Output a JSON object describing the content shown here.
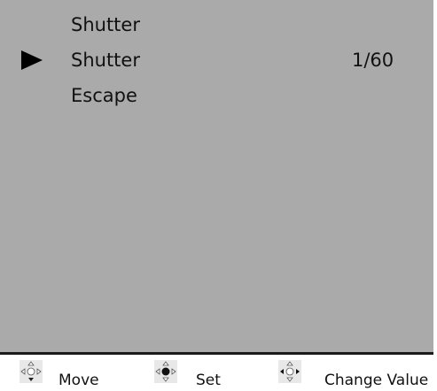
{
  "menu": {
    "items": [
      {
        "label": "Shutter",
        "value": "",
        "selected": false
      },
      {
        "label": "Shutter",
        "value": "1/60",
        "selected": true
      },
      {
        "label": "Escape",
        "value": "",
        "selected": false
      }
    ],
    "cursor_icon": "right-triangle-icon"
  },
  "footer": {
    "hints": [
      {
        "label": "Move",
        "icon": "dpad-move-icon"
      },
      {
        "label": "Set",
        "icon": "dpad-set-icon"
      },
      {
        "label": "Change Value",
        "icon": "dpad-left-right-icon"
      }
    ]
  },
  "colors": {
    "panel_background": "#aaaaaa",
    "text": "#111111",
    "divider": "#1a1a1a",
    "footer_background": "#ffffff"
  }
}
